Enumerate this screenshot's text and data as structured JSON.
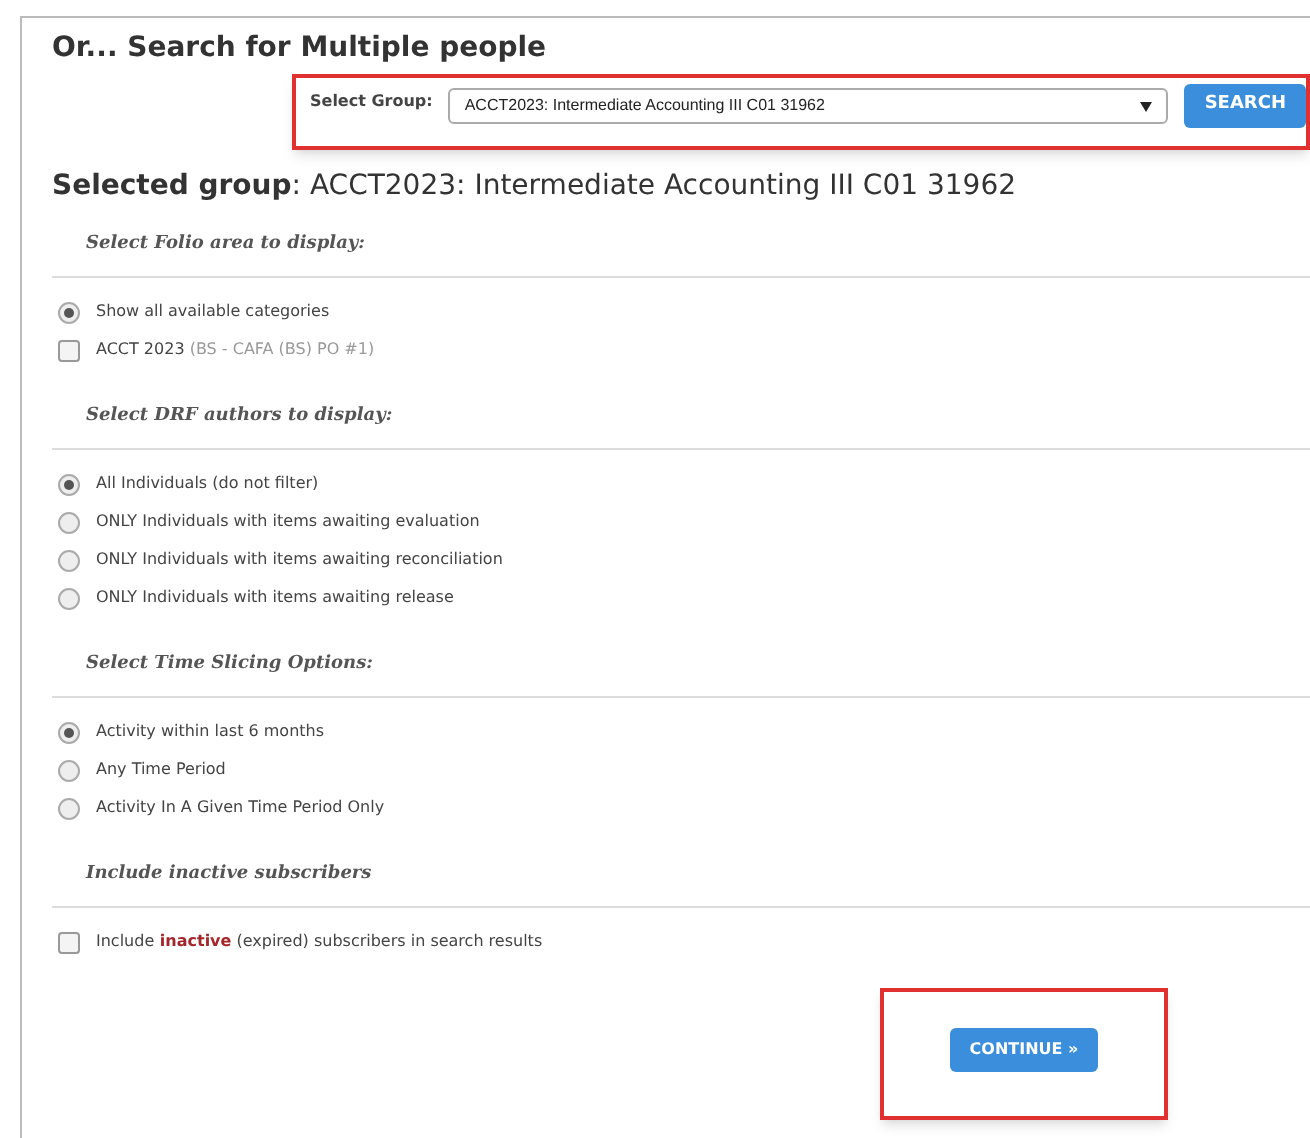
{
  "title": "Or... Search for Multiple people",
  "group_select": {
    "label": "Select Group:",
    "value": "ACCT2023: Intermediate Accounting III C01 31962",
    "highlighted": true
  },
  "search_button": "SEARCH",
  "selected_group": {
    "label": "Selected group",
    "value": ": ACCT2023: Intermediate Accounting III C01 31962"
  },
  "sections": [
    {
      "heading": "Select Folio area to display:",
      "items": [
        {
          "kind": "radio",
          "selected": true,
          "label": "Show all available categories"
        },
        {
          "kind": "checkbox",
          "checked": false,
          "label": "ACCT 2023",
          "note": "(BS - CAFA (BS) PO #1)"
        }
      ]
    },
    {
      "heading": "Select DRF authors to display:",
      "items": [
        {
          "kind": "radio",
          "selected": true,
          "label": "All Individuals (do not filter)"
        },
        {
          "kind": "radio",
          "selected": false,
          "label": "ONLY Individuals with items awaiting evaluation"
        },
        {
          "kind": "radio",
          "selected": false,
          "label": "ONLY Individuals with items awaiting reconciliation"
        },
        {
          "kind": "radio",
          "selected": false,
          "label": "ONLY Individuals with items awaiting release"
        }
      ]
    },
    {
      "heading": "Select Time Slicing Options:",
      "items": [
        {
          "kind": "radio",
          "selected": true,
          "label": "Activity within last 6 months"
        },
        {
          "kind": "radio",
          "selected": false,
          "label": "Any Time Period"
        },
        {
          "kind": "radio",
          "selected": false,
          "label": "Activity In A Given Time Period Only"
        }
      ]
    },
    {
      "heading": "Include inactive subscribers",
      "items": [
        {
          "kind": "checkbox",
          "checked": false,
          "label": "Include",
          "emphasis": "inactive",
          "after": "(expired) subscribers in search results"
        }
      ]
    }
  ],
  "continue_button": {
    "label": "CONTINUE »",
    "highlighted": true
  }
}
